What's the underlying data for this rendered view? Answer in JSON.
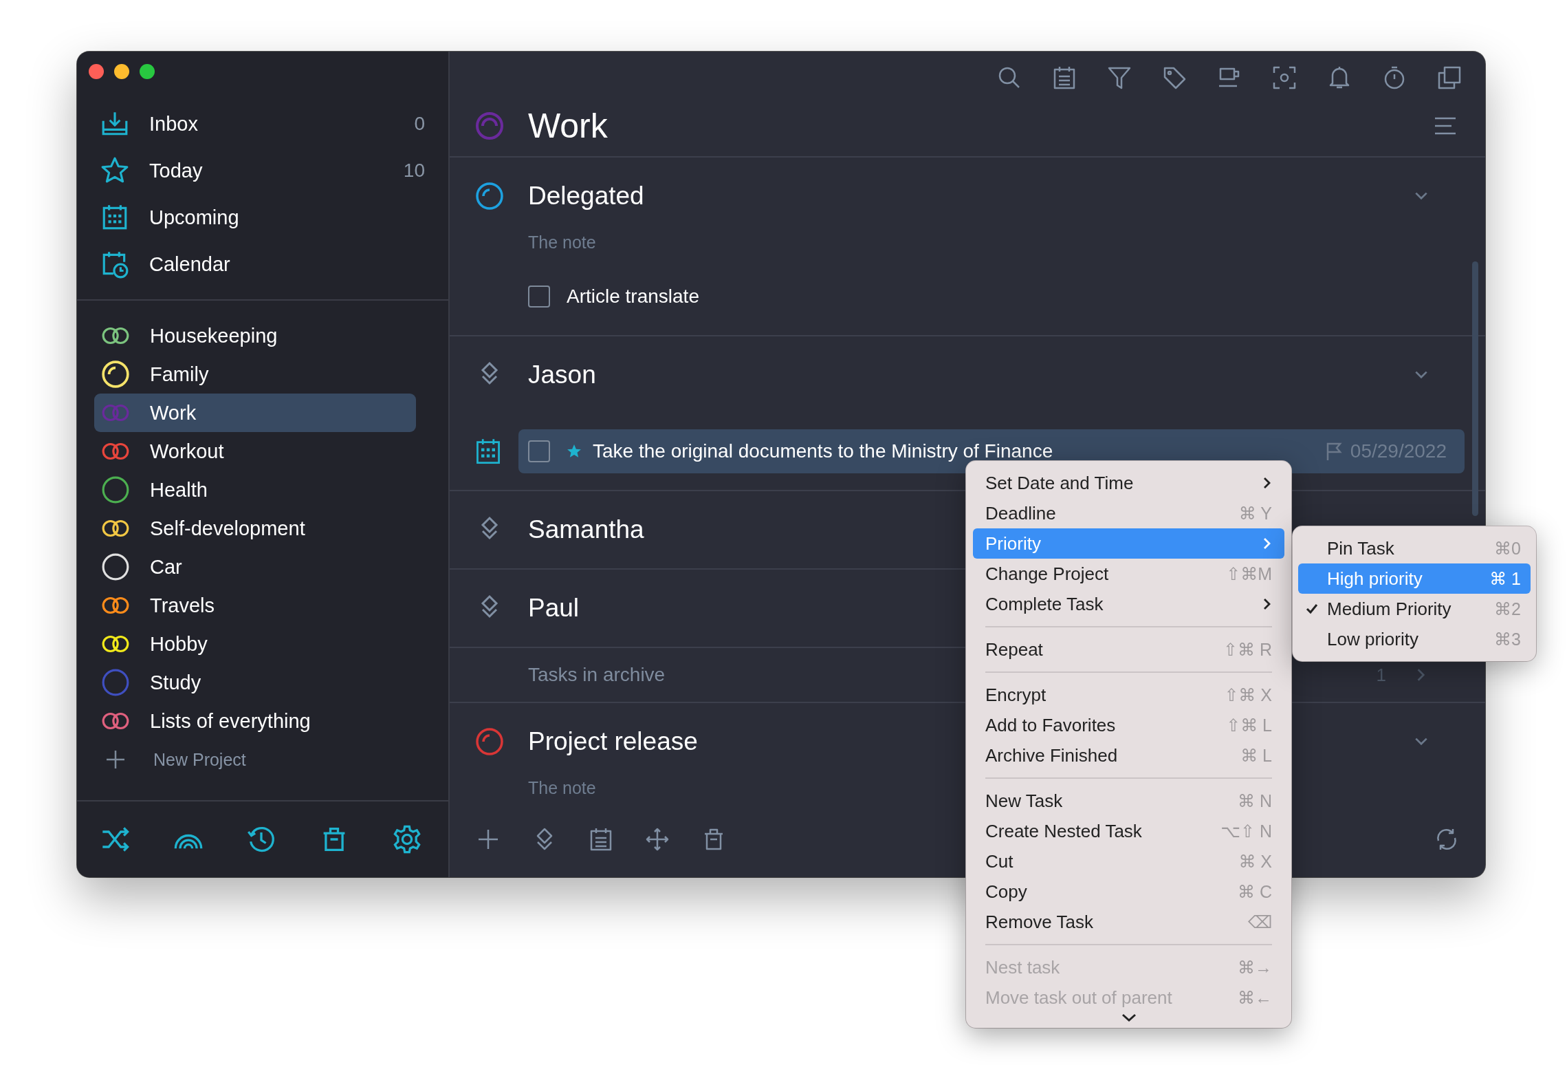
{
  "sidebar": {
    "nav": [
      {
        "kind": "inbox",
        "label": "Inbox",
        "count": "0"
      },
      {
        "kind": "today",
        "label": "Today",
        "count": "10"
      },
      {
        "kind": "upcoming",
        "label": "Upcoming"
      },
      {
        "kind": "calendar",
        "label": "Calendar"
      }
    ],
    "projects": [
      {
        "kind": "linked",
        "label": "Housekeeping",
        "color": "#7cc47f",
        "selected": false
      },
      {
        "kind": "partial",
        "label": "Family",
        "color": "#f5e36a",
        "selected": false
      },
      {
        "kind": "linked",
        "label": "Work",
        "color": "#6a2a9c",
        "selected": true
      },
      {
        "kind": "linked",
        "label": "Workout",
        "color": "#e8453c",
        "selected": false
      },
      {
        "kind": "ring",
        "label": "Health",
        "color": "#4caf50",
        "selected": false
      },
      {
        "kind": "linked",
        "label": "Self-development",
        "color": "#f2c744",
        "selected": false
      },
      {
        "kind": "ring",
        "label": "Car",
        "color": "#e0e0e0",
        "selected": false
      },
      {
        "kind": "linked",
        "label": "Travels",
        "color": "#ff8c1a",
        "selected": false
      },
      {
        "kind": "linked",
        "label": "Hobby",
        "color": "#f2ea1a",
        "selected": false
      },
      {
        "kind": "ring",
        "label": "Study",
        "color": "#3f4fc0",
        "selected": false
      },
      {
        "kind": "linked",
        "label": "Lists of everything",
        "color": "#e0607e",
        "selected": false
      }
    ],
    "new_project": "New Project"
  },
  "main": {
    "title": "Work",
    "sections": [
      {
        "kind": "project",
        "title": "Delegated",
        "color": "#1da1e0",
        "expanded": true,
        "note": "The note",
        "tasks": [
          {
            "label": "Article translate",
            "checked": false,
            "selected": false
          }
        ]
      },
      {
        "kind": "person",
        "title": "Jason",
        "expanded": true,
        "tasks": [
          {
            "label": "Take the original documents to the Ministry of Finance",
            "checked": false,
            "selected": true,
            "starred": true,
            "scheduled": true,
            "deadline": "05/29/2022"
          }
        ]
      },
      {
        "kind": "person",
        "title": "Samantha"
      },
      {
        "kind": "person",
        "title": "Paul"
      },
      {
        "kind": "archive",
        "title": "Tasks in archive",
        "count": "1"
      },
      {
        "kind": "project",
        "title": "Project release",
        "color": "#d93636",
        "expanded": true,
        "note": "The note"
      }
    ]
  },
  "context_menu": {
    "groups": [
      [
        {
          "label": "Set Date and Time",
          "submenu": true,
          "selected": false,
          "disabled": false
        },
        {
          "label": "Deadline",
          "shortcut": "⌘ Y",
          "selected": false,
          "disabled": false
        },
        {
          "label": "Priority",
          "submenu": true,
          "selected": true,
          "disabled": false
        },
        {
          "label": "Change Project",
          "shortcut": "⇧⌘M",
          "selected": false,
          "disabled": false
        },
        {
          "label": "Complete Task",
          "submenu": true,
          "selected": false,
          "disabled": false
        }
      ],
      [
        {
          "label": "Repeat",
          "shortcut": "⇧⌘ R",
          "selected": false,
          "disabled": false
        }
      ],
      [
        {
          "label": "Encrypt",
          "shortcut": "⇧⌘ X",
          "selected": false,
          "disabled": false
        },
        {
          "label": "Add to Favorites",
          "shortcut": "⇧⌘ L",
          "selected": false,
          "disabled": false
        },
        {
          "label": "Archive Finished",
          "shortcut": "⌘ L",
          "selected": false,
          "disabled": false
        }
      ],
      [
        {
          "label": "New Task",
          "shortcut": "⌘ N",
          "selected": false,
          "disabled": false
        },
        {
          "label": "Create Nested Task",
          "shortcut": "⌥⇧ N",
          "selected": false,
          "disabled": false
        },
        {
          "label": "Cut",
          "shortcut": "⌘ X",
          "selected": false,
          "disabled": false
        },
        {
          "label": "Copy",
          "shortcut": "⌘ C",
          "selected": false,
          "disabled": false
        },
        {
          "label": "Remove Task",
          "shortcut": "⌫",
          "selected": false,
          "disabled": false
        }
      ],
      [
        {
          "label": "Nest task",
          "shortcut": "⌘→",
          "selected": false,
          "disabled": true
        },
        {
          "label": "Move task out of parent",
          "shortcut": "⌘←",
          "selected": false,
          "disabled": true
        }
      ]
    ],
    "more_below": true
  },
  "priority_submenu": [
    {
      "label": "Pin Task",
      "shortcut": "⌘0",
      "selected": false,
      "checked": false
    },
    {
      "label": "High priority",
      "shortcut": "⌘ 1",
      "selected": true,
      "checked": false
    },
    {
      "label": "Medium Priority",
      "shortcut": "⌘2",
      "selected": false,
      "checked": true
    },
    {
      "label": "Low priority",
      "shortcut": "⌘3",
      "selected": false,
      "checked": false
    }
  ]
}
